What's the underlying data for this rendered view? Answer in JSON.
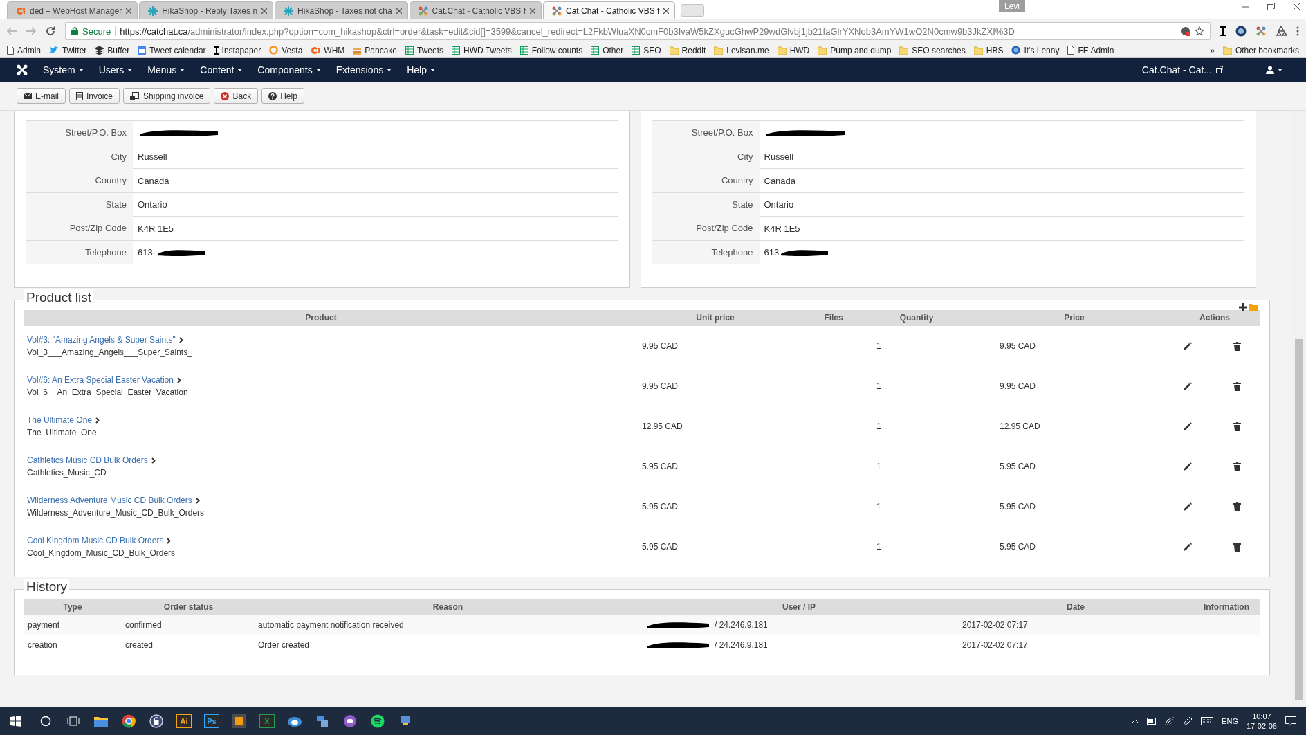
{
  "browser": {
    "tabs": [
      {
        "title": "ded – WebHost Manager",
        "kind": "cpanel",
        "selected": false
      },
      {
        "title": "HikaShop - Reply Taxes n",
        "kind": "hikashop",
        "selected": false
      },
      {
        "title": "HikaShop - Taxes not cha",
        "kind": "hikashop",
        "selected": false
      },
      {
        "title": "Cat.Chat - Catholic VBS f",
        "kind": "joomla",
        "selected": false
      },
      {
        "title": "Cat.Chat - Catholic VBS f",
        "kind": "joomla",
        "selected": true
      }
    ],
    "user_badge": "Levi",
    "secure_label": "Secure",
    "url_host": "https://catchat.ca",
    "url_path": "/administrator/index.php?option=com_hikashop&ctrl=order&task=edit&cid[]=3599&cancel_redirect=L2FkbWluaXN0cmF0b3IvaW5kZXgucGhwP29wdGlvbj1jb21faGlrYXNob3AmYW1wO2N0cmw9b3JkZXI%3D",
    "bookmarks": [
      {
        "label": "Admin",
        "kind": "page"
      },
      {
        "label": "Twitter",
        "kind": "bird"
      },
      {
        "label": "Buffer",
        "kind": "layers"
      },
      {
        "label": "Tweet calendar",
        "kind": "calendar"
      },
      {
        "label": "Instapaper",
        "kind": "bar"
      },
      {
        "label": "Vesta",
        "kind": "ring"
      },
      {
        "label": "WHM",
        "kind": "cpanel"
      },
      {
        "label": "Pancake",
        "kind": "stack"
      },
      {
        "label": "Tweets",
        "kind": "sheet"
      },
      {
        "label": "HWD Tweets",
        "kind": "sheet"
      },
      {
        "label": "Follow counts",
        "kind": "sheet"
      },
      {
        "label": "Other",
        "kind": "sheet"
      },
      {
        "label": "SEO",
        "kind": "sheet"
      },
      {
        "label": "Reddit",
        "kind": "folder"
      },
      {
        "label": "Levisan.me",
        "kind": "folder"
      },
      {
        "label": "HWD",
        "kind": "folder"
      },
      {
        "label": "Pump and dump",
        "kind": "folder"
      },
      {
        "label": "SEO searches",
        "kind": "folder"
      },
      {
        "label": "HBS",
        "kind": "folder"
      },
      {
        "label": "It's Lenny",
        "kind": "globe"
      },
      {
        "label": "FE Admin",
        "kind": "page"
      }
    ],
    "more": "»",
    "other_bookmarks": "Other bookmarks"
  },
  "admin_menu": {
    "items": [
      "System",
      "Users",
      "Menus",
      "Content",
      "Components",
      "Extensions",
      "Help"
    ],
    "site_link": "Cat.Chat - Cat..."
  },
  "toolbar": [
    {
      "label": "E-mail",
      "kind": "email"
    },
    {
      "label": "Invoice",
      "kind": "invoice"
    },
    {
      "label": "Shipping invoice",
      "kind": "shipping"
    },
    {
      "label": "Back",
      "kind": "back"
    },
    {
      "label": "Help",
      "kind": "help"
    }
  ],
  "addresses": [
    {
      "rows": [
        {
          "label": "Street/P.O. Box",
          "redacted": true
        },
        {
          "label": "City",
          "value": "Russell",
          "redacted": false
        },
        {
          "label": "Country",
          "value": "Canada",
          "redacted": false
        },
        {
          "label": "State",
          "value": "Ontario",
          "redacted": false
        },
        {
          "label": "Post/Zip Code",
          "value": "K4R 1E5",
          "redacted": false
        },
        {
          "label": "Telephone",
          "value": "613-",
          "redacted": true
        }
      ]
    },
    {
      "rows": [
        {
          "label": "Street/P.O. Box",
          "redacted": true
        },
        {
          "label": "City",
          "value": "Russell",
          "redacted": false
        },
        {
          "label": "Country",
          "value": "Canada",
          "redacted": false
        },
        {
          "label": "State",
          "value": "Ontario",
          "redacted": false
        },
        {
          "label": "Post/Zip Code",
          "value": "K4R 1E5",
          "redacted": false
        },
        {
          "label": "Telephone",
          "value": "613",
          "redacted": true
        }
      ]
    }
  ],
  "product_list": {
    "title": "Product list",
    "columns": [
      "Product",
      "Unit price",
      "Files",
      "Quantity",
      "Price",
      "Actions"
    ],
    "rows": [
      {
        "name": "Vol#3: \"Amazing Angels & Super Saints\"",
        "code": "Vol_3___Amazing_Angels___Super_Saints_",
        "unit_price": "9.95 CAD",
        "quantity": "1",
        "price": "9.95 CAD"
      },
      {
        "name": "Vol#6: An Extra Special Easter Vacation",
        "code": "Vol_6__An_Extra_Special_Easter_Vacation_",
        "unit_price": "9.95 CAD",
        "quantity": "1",
        "price": "9.95 CAD"
      },
      {
        "name": "The Ultimate One",
        "code": "The_Ultimate_One",
        "unit_price": "12.95 CAD",
        "quantity": "1",
        "price": "12.95 CAD"
      },
      {
        "name": "Cathletics Music CD Bulk Orders",
        "code": "Cathletics_Music_CD",
        "unit_price": "5.95 CAD",
        "quantity": "1",
        "price": "5.95 CAD"
      },
      {
        "name": "Wilderness Adventure Music CD Bulk Orders",
        "code": "Wilderness_Adventure_Music_CD_Bulk_Orders",
        "unit_price": "5.95 CAD",
        "quantity": "1",
        "price": "5.95 CAD"
      },
      {
        "name": "Cool Kingdom Music CD Bulk Orders",
        "code": "Cool_Kingdom_Music_CD_Bulk_Orders",
        "unit_price": "5.95 CAD",
        "quantity": "1",
        "price": "5.95 CAD"
      }
    ]
  },
  "history": {
    "title": "History",
    "columns": [
      "Type",
      "Order status",
      "Reason",
      "User / IP",
      "Date",
      "Information"
    ],
    "rows": [
      {
        "type": "payment",
        "status": "confirmed",
        "reason": "automatic payment notification received",
        "user_ip": "/ 24.246.9.181",
        "date": "2017-02-02 07:17"
      },
      {
        "type": "creation",
        "status": "created",
        "reason": "Order created",
        "user_ip": "/ 24.246.9.181",
        "date": "2017-02-02 07:17"
      }
    ]
  },
  "taskbar": {
    "apps": [
      {
        "kind": "windows"
      },
      {
        "kind": "search"
      },
      {
        "kind": "taskview"
      },
      {
        "kind": "folder"
      },
      {
        "kind": "chrome"
      },
      {
        "kind": "lock"
      },
      {
        "kind": "letter",
        "label": "Ai",
        "color": "#f7a21b"
      },
      {
        "kind": "letter",
        "label": "Ps",
        "color": "#31a8ff"
      },
      {
        "kind": "square"
      },
      {
        "kind": "letter",
        "label": "X",
        "color": "#1f9d55"
      },
      {
        "kind": "bird"
      },
      {
        "kind": "network"
      },
      {
        "kind": "round"
      },
      {
        "kind": "spotify"
      },
      {
        "kind": "pc"
      }
    ],
    "lang": "ENG",
    "time": "10:07",
    "date": "17-02-06"
  }
}
